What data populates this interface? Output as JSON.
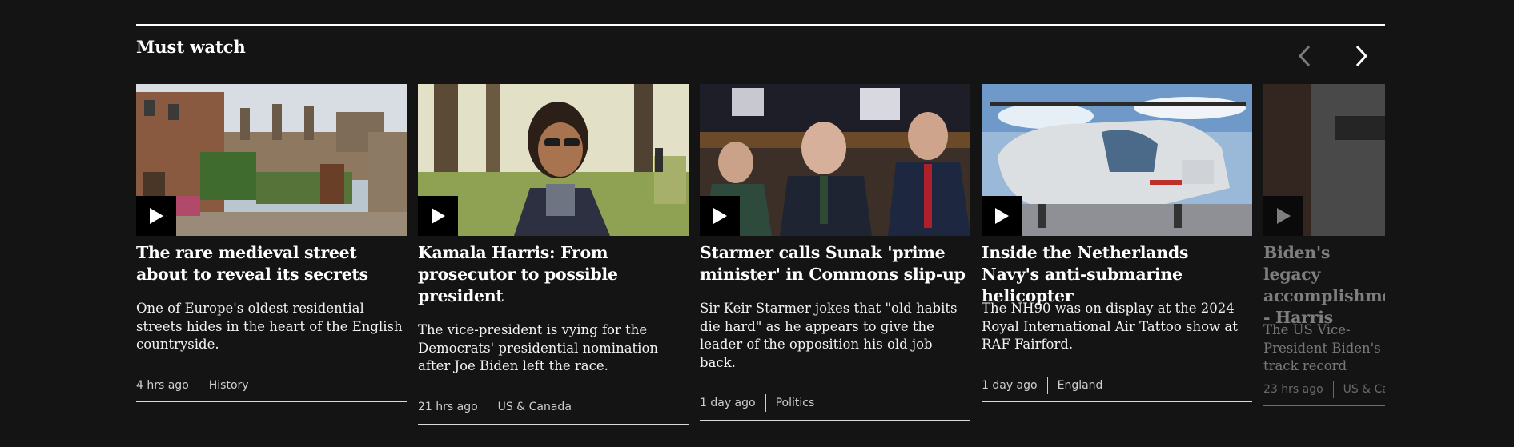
{
  "section": {
    "title": "Must watch",
    "prev_icon": "chevron-left-icon",
    "next_icon": "chevron-right-icon"
  },
  "cards": [
    {
      "headline": "The rare medieval street about to reveal its secrets",
      "summary": "One of Europe's oldest residential streets hides in the heart of the English countryside.",
      "time": "4 hrs ago",
      "category": "History"
    },
    {
      "headline": "Kamala Harris: From prosecutor to possible president",
      "summary": "The vice-president is vying for the Democrats' presidential nomination after Joe Biden left the race.",
      "time": "21 hrs ago",
      "category": "US & Canada"
    },
    {
      "headline": "Starmer calls Sunak 'prime minister' in Commons slip-up",
      "summary": "Sir Keir Starmer jokes that \"old habits die hard\" as he appears to give the leader of the opposition his old job back.",
      "time": "1 day ago",
      "category": "Politics"
    },
    {
      "headline": "Inside the Netherlands Navy's anti-submarine helicopter",
      "summary": "The NH90 was on display at the 2024 Royal International Air Tattoo show at RAF Fairford.",
      "time": "1 day ago",
      "category": "England"
    },
    {
      "headline": "Biden's legacy accomplishments - Harris",
      "summary": "The US Vice-President Biden's track record",
      "time": "23 hrs ago",
      "category": "US & Canada"
    }
  ]
}
